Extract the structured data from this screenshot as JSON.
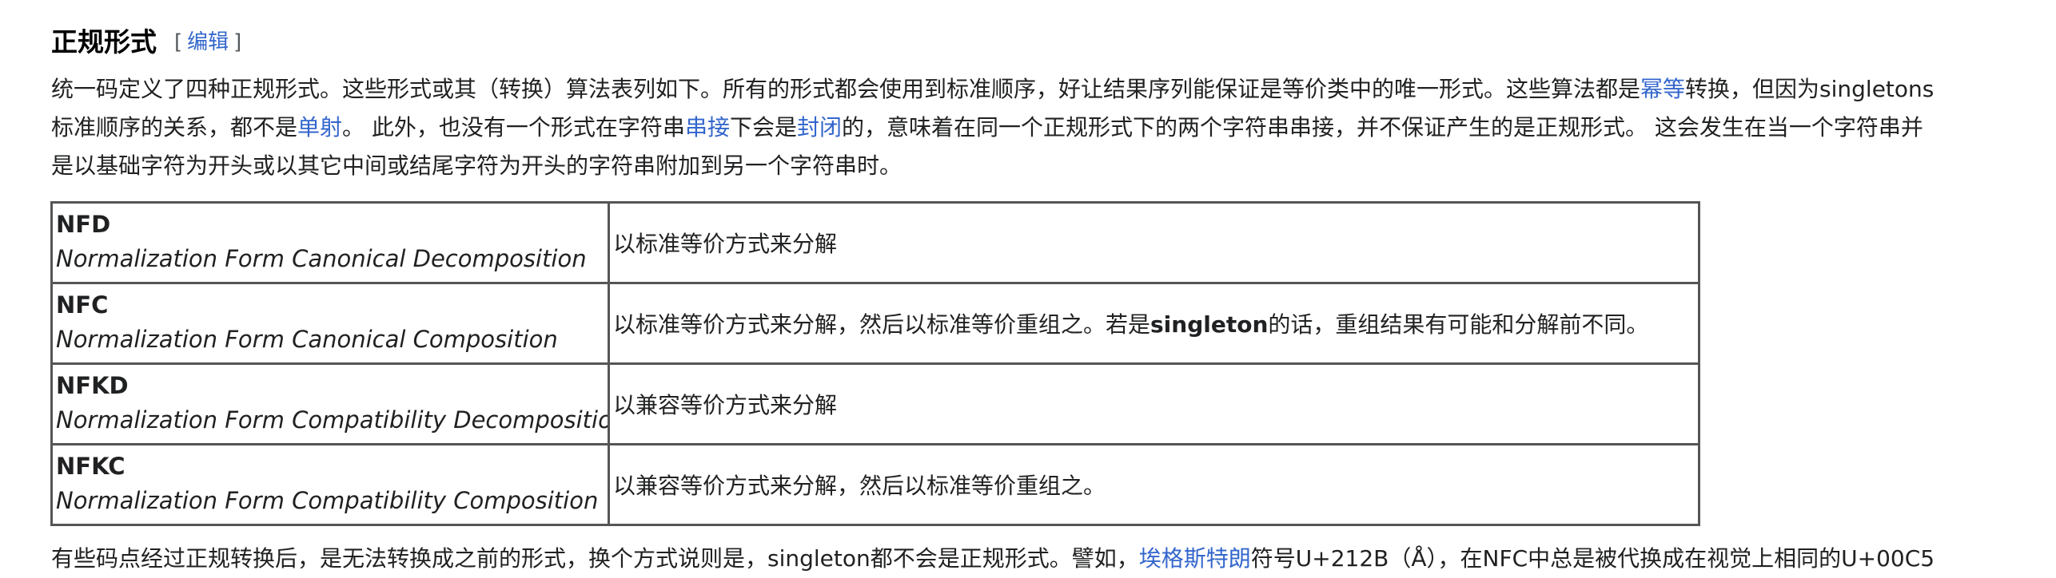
{
  "section": {
    "title": "正规形式",
    "edit_open": "[",
    "edit_label": "编辑",
    "edit_close": "]"
  },
  "intro": {
    "s1": "统一码定义了四种正规形式。这些形式或其（转换）算法表列如下。所有的形式都会使用到标准顺序，好让结果序列能保证是等价类中的唯一形式。这些算法都是",
    "link_idempotent": "幂等",
    "s2": "转换，但因为singletons",
    "s3": "标准顺序的关系，都不是",
    "link_injective": "单射",
    "s4": "。 此外，也没有一个形式在字符串",
    "link_concat": "串接",
    "s5": "下会是",
    "link_closed": "封闭",
    "s6": "的，意味着在同一个正规形式下的两个字符串串接，并不保证产生的是正规形式。 这会发生在当一个字符串并",
    "s7": "是以基础字符为开头或以其它中间或结尾字符为开头的字符串附加到另一个字符串时。"
  },
  "forms": [
    {
      "abbr": "NFD",
      "full": "Normalization Form Canonical Decomposition",
      "desc": "以标准等价方式来分解"
    },
    {
      "abbr": "NFC",
      "full": "Normalization Form Canonical Composition",
      "desc_pre": "以标准等价方式来分解，然后以标准等价重组之。若是",
      "desc_bold": "singleton",
      "desc_post": "的话，重组结果有可能和分解前不同。"
    },
    {
      "abbr": "NFKD",
      "full": "Normalization Form Compatibility Decomposition",
      "desc": "以兼容等价方式来分解"
    },
    {
      "abbr": "NFKC",
      "full": "Normalization Form Compatibility Composition",
      "desc": "以兼容等价方式来分解，然后以标准等价重组之。"
    }
  ],
  "outro": {
    "s1": "有些码点经过正规转换后，是无法转换成之前的形式，换个方式说则是，singleton都不会是正规形式。譬如，",
    "link_angstrom": "埃格斯特朗",
    "s2": "符号U+212B（Å），在NFC中总是被代换成在视觉上相同的U+00C5"
  }
}
